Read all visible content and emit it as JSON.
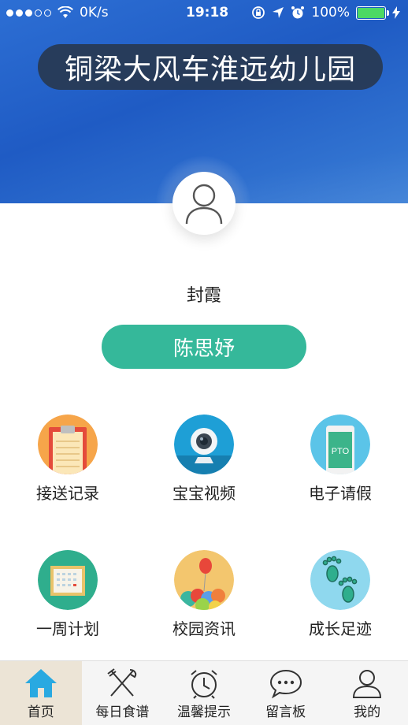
{
  "status_bar": {
    "network": "0K/s",
    "time": "19:18",
    "battery": "100%"
  },
  "header": {
    "title": "铜梁大风车淮远幼儿园"
  },
  "profile": {
    "parent_name": "封霞",
    "child_name": "陈思妤"
  },
  "features": [
    {
      "label": "接送记录",
      "icon": "clipboard-icon"
    },
    {
      "label": "宝宝视频",
      "icon": "webcam-icon"
    },
    {
      "label": "电子请假",
      "icon": "phone-pto-icon"
    },
    {
      "label": "一周计划",
      "icon": "calendar-icon"
    },
    {
      "label": "校园资讯",
      "icon": "balloons-icon"
    },
    {
      "label": "成长足迹",
      "icon": "footprints-icon"
    }
  ],
  "pto_text": "PTO",
  "tabs": [
    {
      "label": "首页",
      "icon": "home-icon",
      "active": true
    },
    {
      "label": "每日食谱",
      "icon": "utensils-icon",
      "active": false
    },
    {
      "label": "温馨提示",
      "icon": "alarm-clock-icon",
      "active": false
    },
    {
      "label": "留言板",
      "icon": "chat-bubble-icon",
      "active": false
    },
    {
      "label": "我的",
      "icon": "user-icon",
      "active": false
    }
  ],
  "colors": {
    "header_blue": "#2d6fd4",
    "accent_green": "#35b89a",
    "home_icon_blue": "#29a9e1"
  }
}
